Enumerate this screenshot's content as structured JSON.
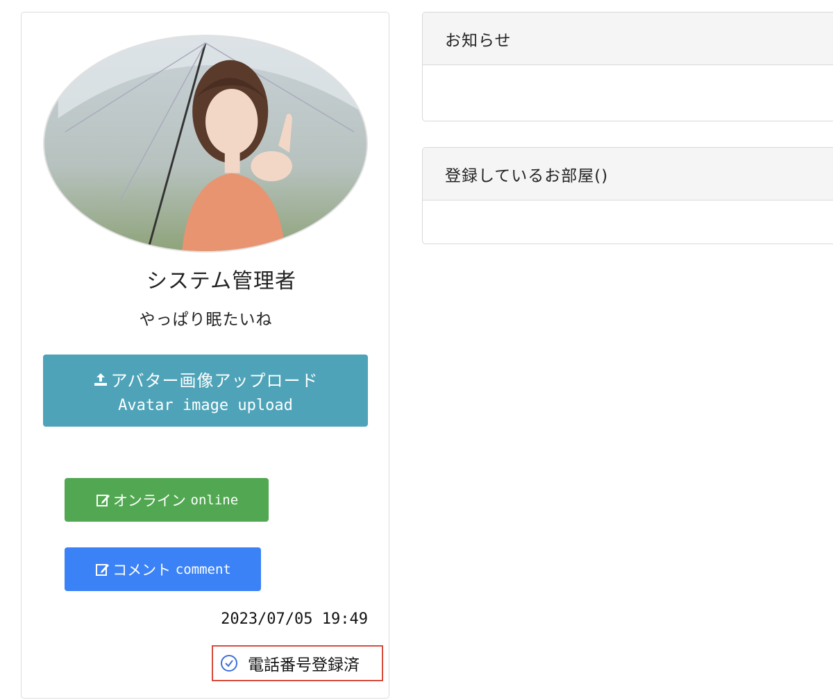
{
  "profile": {
    "name": "システム管理者",
    "status_message": "やっぱり眠たいね",
    "avatar_alt": "avatar-photo",
    "upload_button": {
      "label_ja": "アバター画像アップロード",
      "label_en": "Avatar image upload",
      "icon": "upload-icon"
    },
    "online_button": {
      "label_ja": "オンライン",
      "label_en": "online",
      "icon": "edit-icon"
    },
    "comment_button": {
      "label_ja": "コメント",
      "label_en": "comment",
      "icon": "edit-icon"
    },
    "timestamp": "2023/07/05 19:49",
    "phone_verified": {
      "label": "電話番号登録済",
      "icon": "check-circle-icon"
    }
  },
  "panels": {
    "news": {
      "title": "お知らせ"
    },
    "rooms": {
      "title": "登録しているお部屋()"
    }
  },
  "colors": {
    "upload_button": "#4ea3b8",
    "online_button": "#52a852",
    "comment_button": "#3b82f6",
    "highlight_border": "#d84a3a",
    "check_icon": "#3b6fd8"
  }
}
